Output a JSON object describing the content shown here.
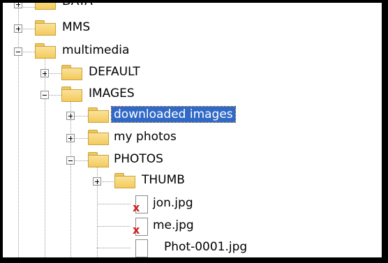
{
  "tree": {
    "items": [
      {
        "label": "DATA",
        "icon": "folder-icon",
        "expander": "plus"
      },
      {
        "label": "MMS",
        "icon": "folder-icon",
        "expander": "plus"
      },
      {
        "label": "multimedia",
        "icon": "folder-icon",
        "expander": "minus"
      },
      {
        "label": "DEFAULT",
        "icon": "folder-icon",
        "expander": "plus"
      },
      {
        "label": "IMAGES",
        "icon": "folder-icon",
        "expander": "minus"
      },
      {
        "label": "downloaded images",
        "icon": "folder-icon",
        "expander": "plus",
        "selected": true
      },
      {
        "label": "my photos",
        "icon": "folder-icon",
        "expander": "plus"
      },
      {
        "label": "PHOTOS",
        "icon": "folder-icon",
        "expander": "minus"
      },
      {
        "label": "THUMB",
        "icon": "folder-icon",
        "expander": "plus"
      },
      {
        "label": "jon.jpg",
        "icon": "broken-image-file-icon"
      },
      {
        "label": "me.jpg",
        "icon": "broken-image-file-icon"
      },
      {
        "label": "Phot-0001.jpg",
        "icon": "file-icon"
      }
    ]
  },
  "colors": {
    "selection": "#3169c6",
    "folder": "#f3cb5c",
    "broken_mark": "#d02020"
  }
}
